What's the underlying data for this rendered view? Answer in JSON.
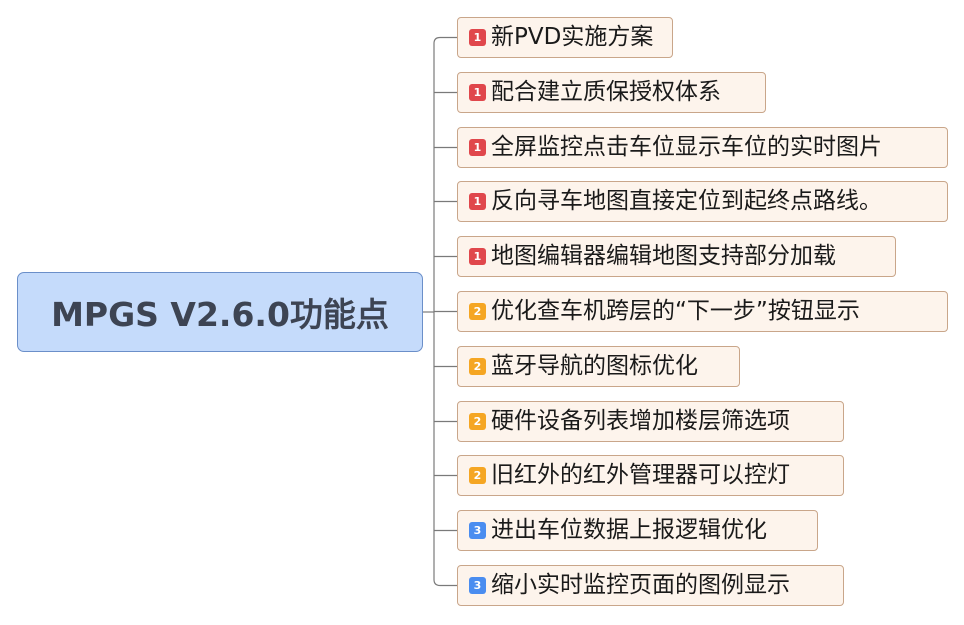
{
  "central_topic": {
    "label": "MPGS V2.6.0功能点"
  },
  "priority_colors": {
    "1": "#e0474c",
    "2": "#f5a623",
    "3": "#4a8df0"
  },
  "branch_color": "#7a7a7a",
  "subtopics": [
    {
      "priority": "1",
      "label": "新PVD实施方案"
    },
    {
      "priority": "1",
      "label": "配合建立质保授权体系"
    },
    {
      "priority": "1",
      "label": "全屏监控点击车位显示车位的实时图片"
    },
    {
      "priority": "1",
      "label": "反向寻车地图直接定位到起终点路线。"
    },
    {
      "priority": "1",
      "label": "地图编辑器编辑地图支持部分加载"
    },
    {
      "priority": "2",
      "label": "优化查车机跨层的“下一步”按钮显示"
    },
    {
      "priority": "2",
      "label": "蓝牙导航的图标优化"
    },
    {
      "priority": "2",
      "label": "硬件设备列表增加楼层筛选项"
    },
    {
      "priority": "2",
      "label": "旧红外的红外管理器可以控灯"
    },
    {
      "priority": "3",
      "label": "进出车位数据上报逻辑优化"
    },
    {
      "priority": "3",
      "label": "缩小实时监控页面的图例显示"
    }
  ]
}
